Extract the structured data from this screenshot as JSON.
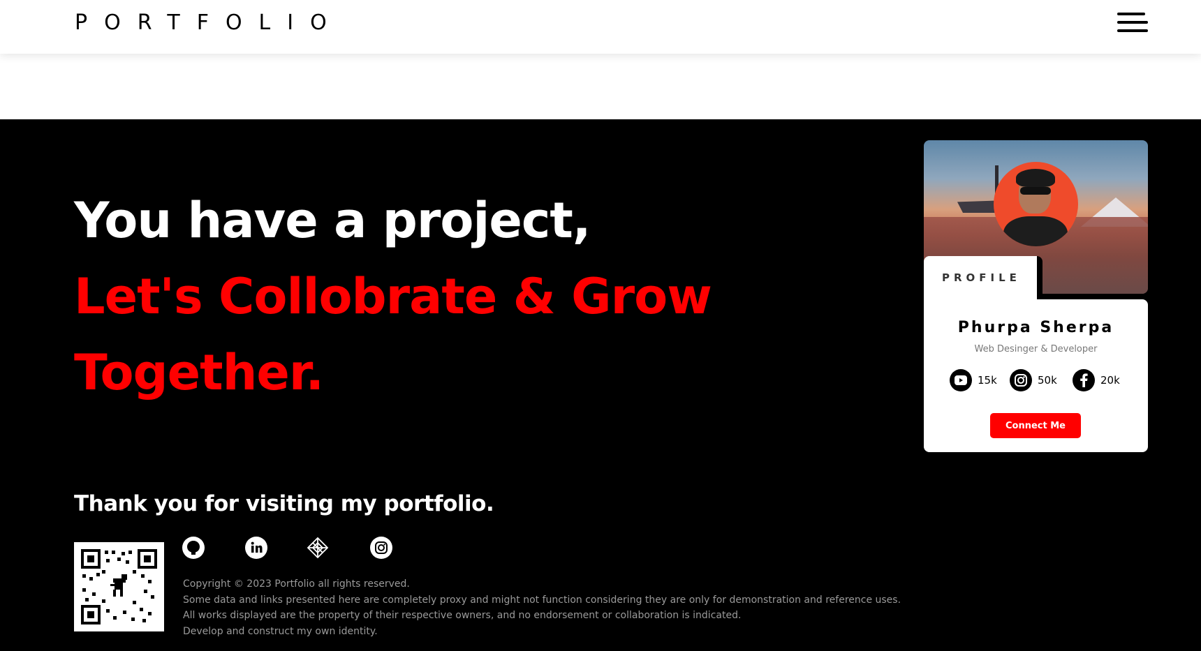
{
  "header": {
    "brand": "PORTFOLIO",
    "menu_icon": "hamburger-menu-icon"
  },
  "hero": {
    "line1": "You have a project,",
    "line2": "Let's Collobrate & Grow",
    "line3": "Together."
  },
  "profile_card": {
    "tab_label": "PROFILE",
    "name": "Phurpa Sherpa",
    "role": "Web Desinger & Developer",
    "stats": [
      {
        "icon": "youtube-icon",
        "value": "15k"
      },
      {
        "icon": "instagram-icon",
        "value": "50k"
      },
      {
        "icon": "facebook-icon",
        "value": "20k"
      }
    ],
    "connect_label": "Connect Me"
  },
  "footer": {
    "thanks": "Thank you for visiting my portfolio.",
    "social": [
      "github-icon",
      "linkedin-icon",
      "codepen-icon",
      "instagram-icon"
    ],
    "copyright": "Copyright © 2023 Portfolio all rights reserved.",
    "disclaimer1": "Some data and links presented here are completely proxy and might not function considering they are only for demonstration and reference uses.",
    "disclaimer2": "All works displayed are the property of their respective owners, and no endorsement or collaboration is indicated.",
    "disclaimer3": "Develop and construct my own identity."
  },
  "colors": {
    "accent": "#ff0000",
    "background": "#000000",
    "text": "#ffffff",
    "muted": "#9a9a9a"
  }
}
